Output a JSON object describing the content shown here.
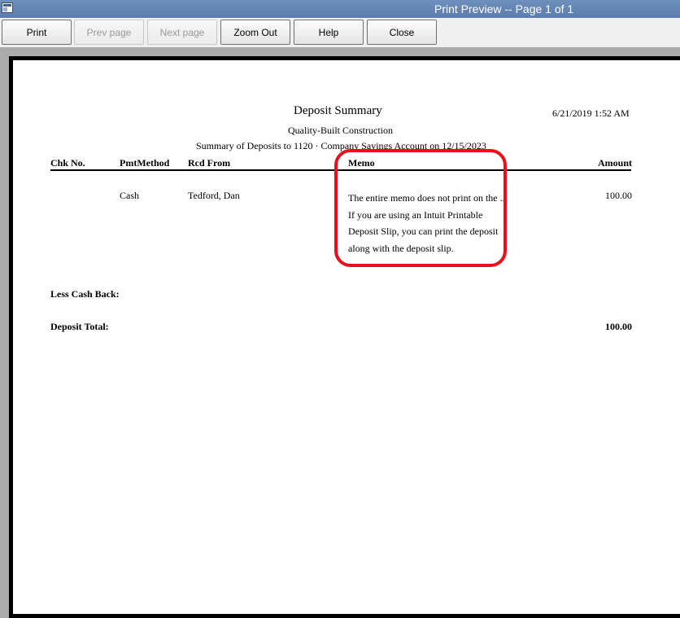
{
  "window": {
    "title": "Print Preview -- Page 1 of 1"
  },
  "toolbar": {
    "print_label": "Print",
    "prev_label": "Prev page",
    "next_label": "Next page",
    "zoom_label": "Zoom Out",
    "help_label": "Help",
    "close_label": "Close"
  },
  "report": {
    "title": "Deposit Summary",
    "company": "Quality-Built Construction",
    "subtitle": "Summary of Deposits to 1120 · Company Savings Account on 12/15/2023",
    "datetime": "6/21/2019 1:52 AM",
    "columns": {
      "chk": "Chk No.",
      "pmt": "PmtMethod",
      "rcd": "Rcd From",
      "memo": "Memo",
      "amount": "Amount"
    },
    "rows": [
      {
        "chk": "",
        "pmt": "Cash",
        "rcd": "Tedford, Dan",
        "memo_lines": [
          "The entire memo does not print on the ..",
          "If you are using an Intuit Printable",
          "Deposit Slip, you can print the deposit",
          "along with the deposit slip."
        ],
        "amount": "100.00"
      }
    ],
    "less_cash_back_label": "Less Cash Back:",
    "deposit_total_label": "Deposit Total:",
    "deposit_total": "100.00"
  },
  "annotation": {
    "highlight_color": "#e8101a"
  }
}
